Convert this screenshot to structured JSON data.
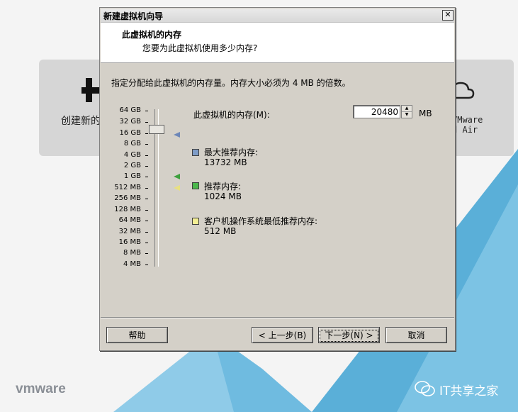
{
  "background": {
    "create_text": "创建新的",
    "vair_text": "VMware\nd Air",
    "logo": "vmware",
    "watermark": "IT共享之家",
    "accent_blue": "#5aafd8",
    "icons": [
      "plus-icon",
      "cloud-icon",
      "wechat-icon"
    ]
  },
  "dialog": {
    "title": "新建虚拟机向导",
    "close_label": "✕",
    "header_title": "此虚拟机的内存",
    "header_subtitle": "您要为此虚拟机使用多少内存?",
    "instruction": "指定分配给此虚拟机的内存量。内存大小必须为 4 MB 的倍数。",
    "scale_labels": [
      "64 GB",
      "32 GB",
      "16 GB",
      "8 GB",
      "4 GB",
      "2 GB",
      "1 GB",
      "512 MB",
      "256 MB",
      "128 MB",
      "64 MB",
      "32 MB",
      "16 MB",
      "8 MB",
      "4 MB"
    ],
    "memory_label": "此虚拟机的内存(M):",
    "memory_value": "20480",
    "memory_unit": "MB",
    "legend": [
      {
        "title": "最大推荐内存:",
        "value": "13732 MB",
        "color": "#7e9cc7"
      },
      {
        "title": "推荐内存:",
        "value": "1024 MB",
        "color": "#4cb84c"
      },
      {
        "title": "客户机操作系统最低推荐内存:",
        "value": "512 MB",
        "color": "#f3ee94"
      }
    ],
    "buttons": {
      "help": "帮助",
      "back": "< 上一步(B)",
      "next": "下一步(N) >",
      "cancel": "取消"
    }
  }
}
